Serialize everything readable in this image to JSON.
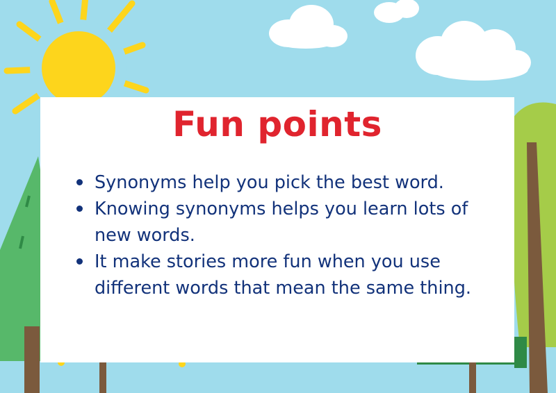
{
  "title": "Fun points",
  "bullets": [
    "Synonyms help you pick the best word.",
    "Knowing synonyms helps you learn lots of new words.",
    "It make stories more fun when you use different words that mean the same thing."
  ],
  "colors": {
    "sky": "#9fdcec",
    "sun": "#fdd51c",
    "title": "#e0242e",
    "text": "#12327a"
  }
}
